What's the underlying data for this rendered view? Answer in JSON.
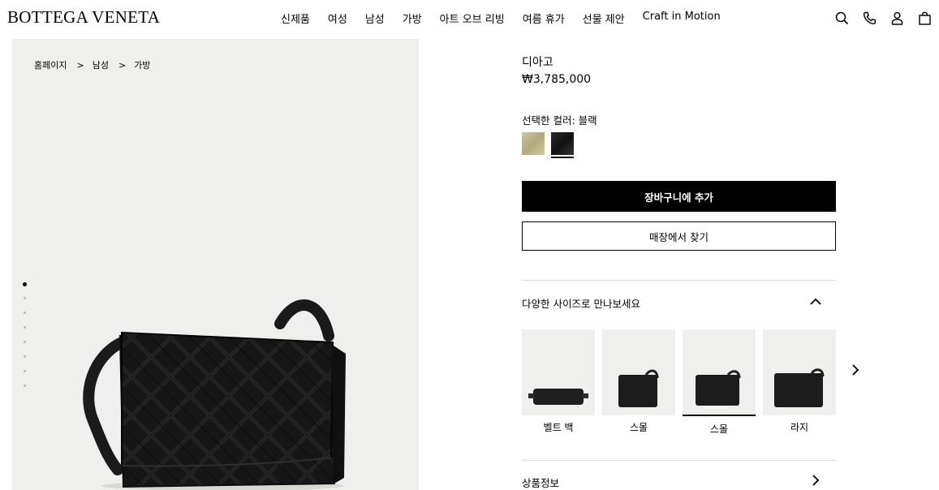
{
  "header": {
    "logo": "BOTTEGA VENETA",
    "nav": [
      "신제품",
      "여성",
      "남성",
      "가방",
      "아트 오브 리빙",
      "여름 휴가",
      "선물 제안",
      "Craft in Motion"
    ],
    "icons": [
      "search-icon",
      "phone-icon",
      "user-icon",
      "bag-icon"
    ]
  },
  "breadcrumb": {
    "items": [
      "홈페이지",
      "남성",
      "가방"
    ],
    "separator": ">"
  },
  "gallery": {
    "dot_count": 8,
    "active_dot": 1,
    "background": "#eff0ee"
  },
  "product": {
    "name": "디아고",
    "price": "₩3,785,000",
    "color_label": "선택한 컬러: 블랙",
    "colors": [
      "#c2b88f",
      "#1a1a1a"
    ],
    "selected_color": 2
  },
  "actions": {
    "add_to_cart": "장바구니에 추가",
    "find_in_store": "매장에서 찾기"
  },
  "sizes": {
    "heading": "다양한 사이즈로 만나보세요",
    "items": [
      {
        "label": "벨트 백"
      },
      {
        "label": "스몰"
      },
      {
        "label": "스몰"
      },
      {
        "label": "라지"
      }
    ],
    "selected_index": 2
  },
  "details": {
    "heading": "상품정보"
  }
}
